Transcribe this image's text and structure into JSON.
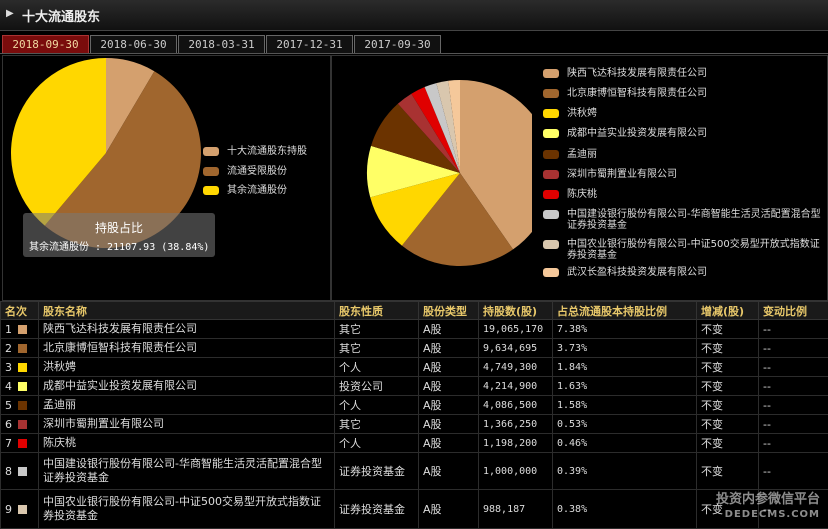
{
  "header": {
    "title": "十大流通股东"
  },
  "tabs": [
    {
      "label": "2018-09-30",
      "active": true
    },
    {
      "label": "2018-06-30"
    },
    {
      "label": "2018-03-31"
    },
    {
      "label": "2017-12-31"
    },
    {
      "label": "2017-09-30"
    }
  ],
  "left_chart": {
    "legend": [
      "十大流通股东持股",
      "流通受限股份",
      "其余流通股份"
    ],
    "tooltip_title": "持股占比",
    "tooltip_text": "其余流通股份 : 21107.93 (38.84%)"
  },
  "right_chart": {
    "legend": [
      "陕西飞达科技发展有限责任公司",
      "北京康博恒智科技有限责任公司",
      "洪秋娉",
      "成都中益实业投资发展有限公司",
      "孟迪丽",
      "深圳市蜀荆置业有限公司",
      "陈庆桃",
      "中国建设银行股份有限公司-华商智能生活灵活配置混合型证券投资基金",
      "中国农业银行股份有限公司-中证500交易型开放式指数证券投资基金",
      "武汉长盈科技投资发展有限公司"
    ]
  },
  "colors": [
    "#d4a06e",
    "#a0662e",
    "#ffd700",
    "#ffff66",
    "#6b3300",
    "#a83232",
    "#e00000",
    "#c8c8c8",
    "#d9c7ae",
    "#f5c89a"
  ],
  "chart_data": [
    {
      "type": "pie",
      "title": "持股占比",
      "categories": [
        "十大流通股东持股",
        "流通受限股份",
        "其余流通股份"
      ],
      "values": [
        8.5,
        52.66,
        38.84
      ],
      "colors": [
        "#d4a06e",
        "#a0662e",
        "#ffd700"
      ]
    },
    {
      "type": "pie",
      "categories": [
        "陕西飞达科技发展有限责任公司",
        "北京康博恒智科技有限责任公司",
        "洪秋娉",
        "成都中益实业投资发展有限公司",
        "孟迪丽",
        "深圳市蜀荆置业有限公司",
        "陈庆桃",
        "中国建设银行股份有限公司-华商智能生活灵活配置混合型证券投资基金",
        "中国农业银行股份有限公司-中证500交易型开放式指数证券投资基金",
        "武汉长盈科技投资发展有限公司"
      ],
      "values": [
        19065170,
        9634695,
        4749300,
        4214900,
        4086500,
        1366250,
        1198200,
        1000000,
        988187,
        950000
      ]
    }
  ],
  "table": {
    "headers": [
      "名次",
      "股东名称",
      "股东性质",
      "股份类型",
      "持股数(股)",
      "占总流通股本持股比例",
      "增减(股)",
      "变动比例"
    ],
    "rows": [
      {
        "rank": "1",
        "name": "陕西飞达科技发展有限责任公司",
        "nature": "其它",
        "type": "A股",
        "shares": "19,065,170",
        "ratio": "7.38%",
        "change": "不变",
        "change_ratio": "--"
      },
      {
        "rank": "2",
        "name": "北京康博恒智科技有限责任公司",
        "nature": "其它",
        "type": "A股",
        "shares": "9,634,695",
        "ratio": "3.73%",
        "change": "不变",
        "change_ratio": "--"
      },
      {
        "rank": "3",
        "name": "洪秋娉",
        "nature": "个人",
        "type": "A股",
        "shares": "4,749,300",
        "ratio": "1.84%",
        "change": "不变",
        "change_ratio": "--"
      },
      {
        "rank": "4",
        "name": "成都中益实业投资发展有限公司",
        "nature": "投资公司",
        "type": "A股",
        "shares": "4,214,900",
        "ratio": "1.63%",
        "change": "不变",
        "change_ratio": "--"
      },
      {
        "rank": "5",
        "name": "孟迪丽",
        "nature": "个人",
        "type": "A股",
        "shares": "4,086,500",
        "ratio": "1.58%",
        "change": "不变",
        "change_ratio": "--"
      },
      {
        "rank": "6",
        "name": "深圳市蜀荆置业有限公司",
        "nature": "其它",
        "type": "A股",
        "shares": "1,366,250",
        "ratio": "0.53%",
        "change": "不变",
        "change_ratio": "--"
      },
      {
        "rank": "7",
        "name": "陈庆桃",
        "nature": "个人",
        "type": "A股",
        "shares": "1,198,200",
        "ratio": "0.46%",
        "change": "不变",
        "change_ratio": "--"
      },
      {
        "rank": "8",
        "name": "中国建设银行股份有限公司-华商智能生活灵活配置混合型证券投资基金",
        "nature": "证券投资基金",
        "type": "A股",
        "shares": "1,000,000",
        "ratio": "0.39%",
        "change": "不变",
        "change_ratio": "--"
      },
      {
        "rank": "9",
        "name": "中国农业银行股份有限公司-中证500交易型开放式指数证券投资基金",
        "nature": "证券投资基金",
        "type": "A股",
        "shares": "988,187",
        "ratio": "0.38%",
        "change": "不变",
        "change_ratio": "--"
      }
    ]
  },
  "watermark": {
    "line1": "投资内参微信平台",
    "line2": "DEDECMS.COM"
  }
}
